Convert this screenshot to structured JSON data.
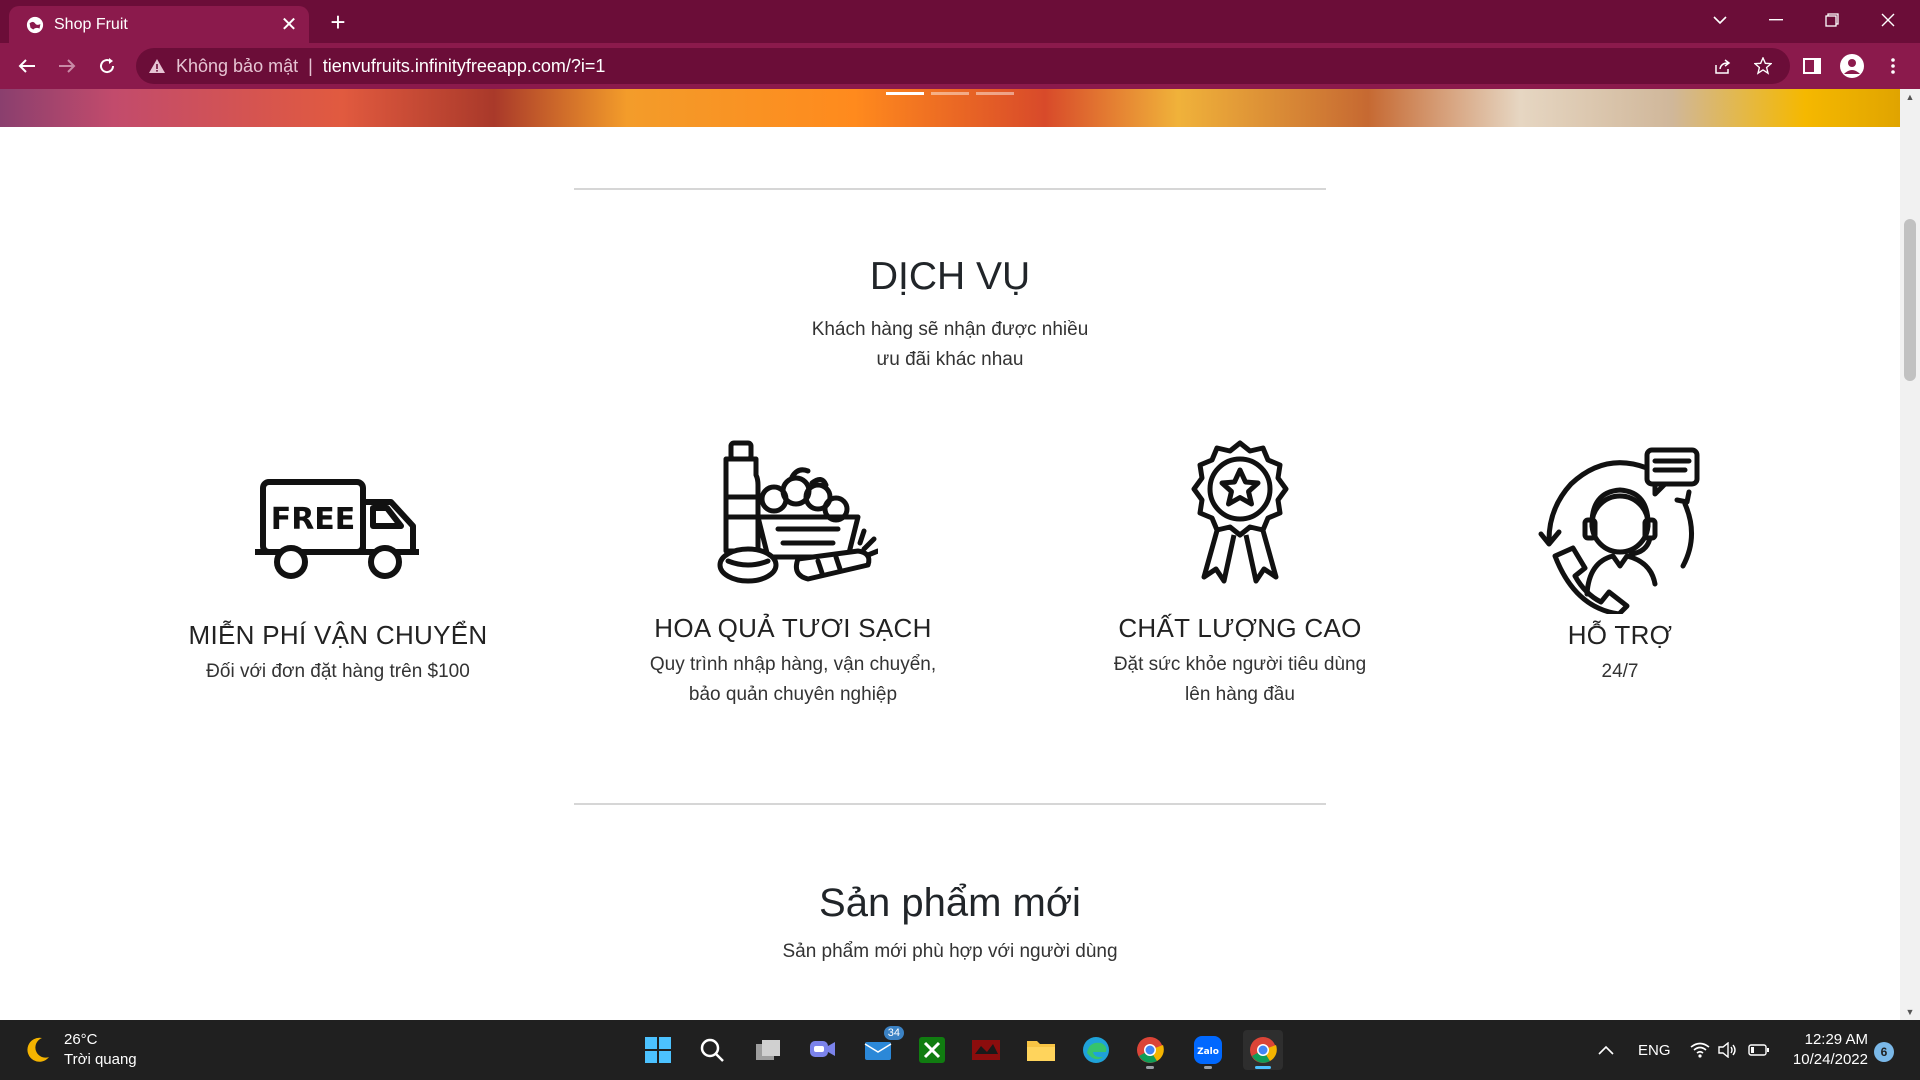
{
  "browser": {
    "tab_title": "Shop Fruit",
    "tab_close": "✕",
    "new_tab": "+",
    "security_label": "Không bảo mật",
    "separator": "|",
    "url": "tienvufruits.infinityfreeapp.com/?i=1"
  },
  "services": {
    "title": "DỊCH VỤ",
    "subtitle_line1": "Khách hàng sẽ nhận được nhiều",
    "subtitle_line2": "ưu đãi khác nhau",
    "items": [
      {
        "name": "MIỄN PHÍ VẬN CHUYỂN",
        "desc_line1": "Đối với đơn đặt hàng trên $100",
        "desc_line2": "",
        "icon": "free-delivery-truck-icon"
      },
      {
        "name": "HOA QUẢ TƯƠI SẠCH",
        "desc_line1": "Quy trình nhập hàng, vận chuyển,",
        "desc_line2": "bảo quản chuyên nghiệp",
        "icon": "fresh-groceries-icon"
      },
      {
        "name": "CHẤT LƯỢNG CAO",
        "desc_line1": "Đặt sức khỏe người tiêu dùng",
        "desc_line2": "lên hàng đầu",
        "icon": "quality-award-icon"
      },
      {
        "name": "HỖ TRỢ",
        "desc_line1": "24/7",
        "desc_line2": "",
        "icon": "customer-support-icon"
      }
    ]
  },
  "new_products": {
    "title": "Sản phẩm mới",
    "subtitle": "Sản phẩm mới phù hợp với người dùng"
  },
  "taskbar": {
    "temperature": "26°C",
    "weather_text": "Trời quang",
    "mail_badge": "34",
    "language": "ENG",
    "time": "12:29 AM",
    "date": "10/24/2022",
    "notification_count": "6"
  }
}
